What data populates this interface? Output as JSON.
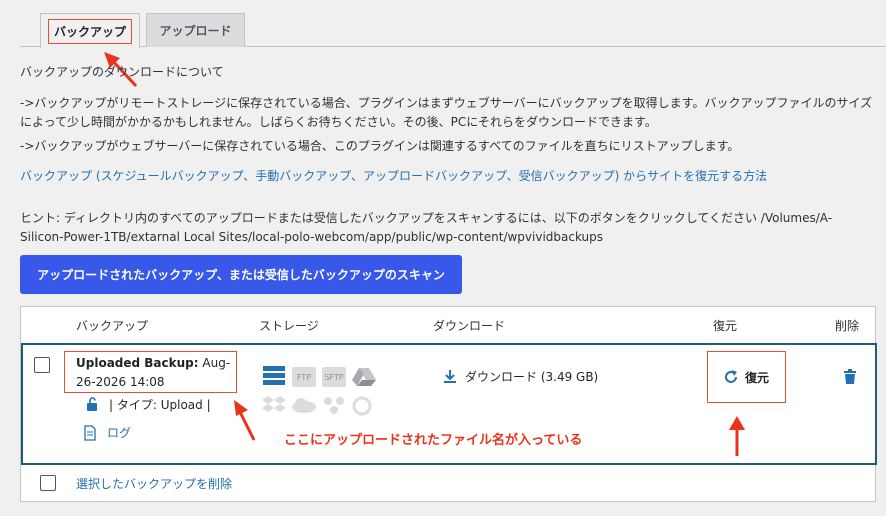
{
  "tabs": [
    {
      "label": "バックアップ",
      "active": true
    },
    {
      "label": "アップロード",
      "active": false
    }
  ],
  "section_title": "バックアップのダウンロードについて",
  "info": {
    "line1a": "->バックアップがリモートストレージに保存されている場合、プラグインはまずウェブサーバーにバックアップを取得します。バックアップファイルのサイズ",
    "line1b": "によって少し時間がかかるかもしれません。しばらくお待ちください。その後、PCにそれらをダウンロードできます。",
    "line2": "->バックアップがウェブサーバーに保存されている場合、このプラグインは関連するすべてのファイルを直ちにリストアップします。"
  },
  "restore_link": "バックアップ (スケジュールバックアップ、手動バックアップ、アップロードバックアップ、受信バックアップ) からサイトを復元する方法",
  "hint": {
    "line1": "ヒント: ディレクトリ内のすべてのアップロードまたは受信したバックアップをスキャンするには、以下のボタンをクリックしてください /Volumes/A-",
    "line2": "Silicon-Power-1TB/extarnal Local Sites/local-polo-webcom/app/public/wp-content/wpvividbackups"
  },
  "scan_button": "アップロードされたバックアップ、または受信したバックアップのスキャン",
  "table": {
    "headers": {
      "backup": "バックアップ",
      "storage": "ストレージ",
      "download": "ダウンロード",
      "restore": "復元",
      "delete": "削除"
    },
    "row": {
      "title_bold": "Uploaded Backup:",
      "title_date1": "Aug-",
      "title_date2": "26-2026 14:08",
      "type": "| タイプ: Upload |",
      "log": "ログ",
      "storage_icons": [
        "server-icon",
        "ftp-icon",
        "sftp-icon",
        "google-drive-icon",
        "dropbox-icon",
        "onedrive-icon",
        "s3-icon",
        "wasabi-icon"
      ],
      "storage_ftp": "FTP",
      "storage_sftp": "SFTP",
      "download_label": "ダウンロード (3.49 GB)",
      "restore_label": "復元"
    },
    "delete_selected": "選択したバックアップを削除"
  },
  "annotation": "ここにアップロードされたファイル名が入っている",
  "colors": {
    "accent": "#3858e9",
    "annotation": "#e8341c",
    "link": "#2271b1"
  }
}
